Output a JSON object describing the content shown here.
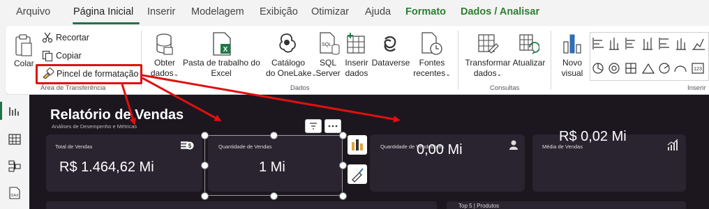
{
  "tabs": [
    {
      "label": "Arquivo"
    },
    {
      "label": "Página Inicial"
    },
    {
      "label": "Inserir"
    },
    {
      "label": "Modelagem"
    },
    {
      "label": "Exibição"
    },
    {
      "label": "Otimizar"
    },
    {
      "label": "Ajuda"
    },
    {
      "label": "Formato"
    },
    {
      "label": "Dados / Analisar"
    }
  ],
  "ribbon": {
    "clipboard": {
      "paste_label": "Colar",
      "cut_label": "Recortar",
      "copy_label": "Copiar",
      "format_painter_label": "Pincel de formatação",
      "group_label": "Área de Transferência"
    },
    "data": {
      "get_data_line1": "Obter",
      "get_data_line2": "dados",
      "excel_line1": "Pasta de trabalho do",
      "excel_line2": "Excel",
      "onelake_line1": "Catálogo",
      "onelake_line2": "do OneLake",
      "sql_line1": "SQL",
      "sql_line2": "Server",
      "insert_line1": "Inserir",
      "insert_line2": "dados",
      "dataverse_label": "Dataverse",
      "recent_line1": "Fontes",
      "recent_line2": "recentes",
      "group_label": "Dados"
    },
    "queries": {
      "transform_line1": "Transformar",
      "transform_line2": "dados",
      "refresh_label": "Atualizar",
      "group_label": "Consultas"
    },
    "insert": {
      "new_visual_line1": "Novo",
      "new_visual_line2": "visual",
      "group_label": "Inserir"
    },
    "chevron": "⌄"
  },
  "report": {
    "title": "Relatório de Vendas",
    "subtitle": "Análises de Desempenho e Métricas",
    "cards": [
      {
        "label": "Total de Vendas",
        "value": "R$ 1.464,62 Mi"
      },
      {
        "label": "Quantidade de Vendas",
        "value": "1 Mi"
      },
      {
        "label": "Quantidade de Vendedores",
        "value": "0,00 Mi"
      },
      {
        "label": "Média de Vendas",
        "value": "R$ 0,02 Mi"
      }
    ],
    "bottom_label": "Top 5 | Produtos"
  },
  "colors": {
    "accent_green": "#217346",
    "annotation_red": "#e01010",
    "canvas_bg": "#1c171f",
    "card_bg": "#2a2430"
  }
}
